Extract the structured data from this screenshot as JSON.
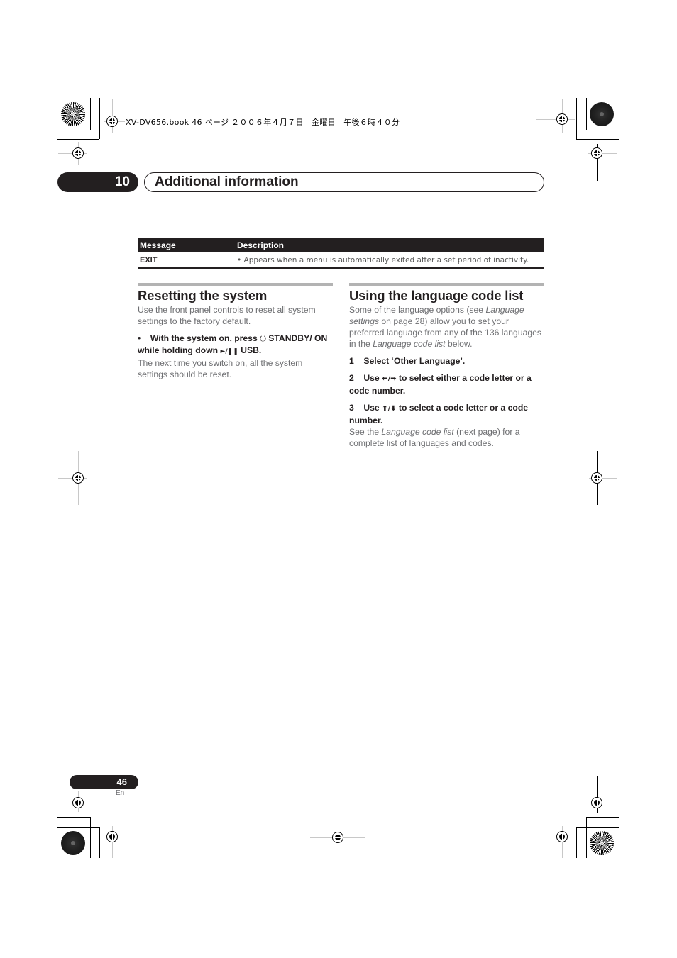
{
  "print_header": "XV-DV656.book  46 ページ  ２００６年４月７日　金曜日　午後６時４０分",
  "chapter": {
    "number": "10",
    "title": "Additional information"
  },
  "message_table": {
    "headers": [
      "Message",
      "Description"
    ],
    "rows": [
      {
        "message": "EXIT",
        "description": "• Appears when a menu is automatically exited after a set period of inactivity."
      }
    ]
  },
  "resetting": {
    "heading": "Resetting the system",
    "intro": "Use the front panel controls to reset all system settings to the factory default.",
    "bullet_marker": "•",
    "instruction_part1": "With the system on, press ",
    "standby_icon": "⏻",
    "instruction_part2": " STANDBY/ ON while holding down ",
    "play_pause_icon": "►/❚❚",
    "instruction_part3": " USB.",
    "result": "The next time you switch on, all the system settings should be reset."
  },
  "language_code": {
    "heading": "Using the language code list",
    "intro_part1": "Some of the language options (see ",
    "intro_em1": "Language settings",
    "intro_part2": " on page 28) allow you to set your preferred language from any of the 136 languages in the ",
    "intro_em2": "Language code list",
    "intro_part3": " below.",
    "steps": [
      {
        "num": "1",
        "text": "Select ‘Other Language’."
      },
      {
        "num": "2",
        "pre": "Use ",
        "icon": "⬅/➡",
        "text": " to select either a code letter or a code number."
      },
      {
        "num": "3",
        "pre": "Use ",
        "icon": "⬆/⬇",
        "text": " to select a code letter or a code number."
      }
    ],
    "footer_part1": "See the ",
    "footer_em": "Language code list",
    "footer_part2": " (next page) for a complete list of languages and codes."
  },
  "footer": {
    "page_number": "46",
    "language": "En"
  }
}
